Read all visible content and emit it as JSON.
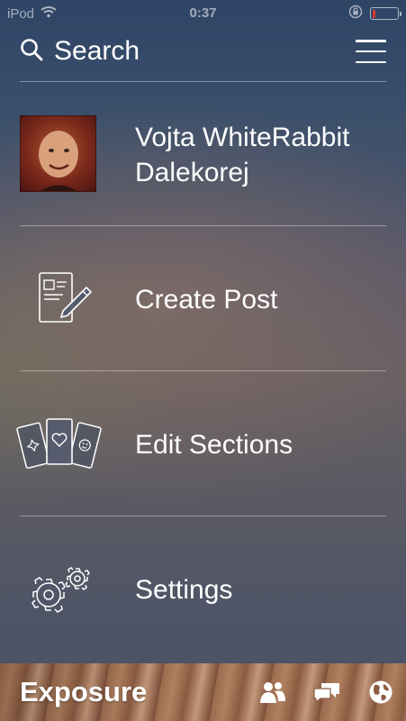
{
  "status_bar": {
    "carrier": "iPod",
    "time": "0:37",
    "battery_color": "#d9362e",
    "battery_level": 0.12,
    "icons": [
      "wifi-icon",
      "orientation-lock-icon",
      "battery-icon"
    ]
  },
  "header": {
    "search_label": "Search",
    "icons": [
      "search-icon",
      "hamburger-menu-icon"
    ]
  },
  "menu": {
    "profile": {
      "name": "Vojta WhiteRabbit Dalekorej",
      "icon": "avatar"
    },
    "create_post": {
      "label": "Create Post",
      "icon": "create-post-icon"
    },
    "edit_sections": {
      "label": "Edit Sections",
      "icon": "cards-icon"
    },
    "settings": {
      "label": "Settings",
      "icon": "gears-icon"
    }
  },
  "footer": {
    "brand": "Exposure",
    "icons": [
      "people-icon",
      "chat-icon",
      "globe-icon"
    ]
  }
}
